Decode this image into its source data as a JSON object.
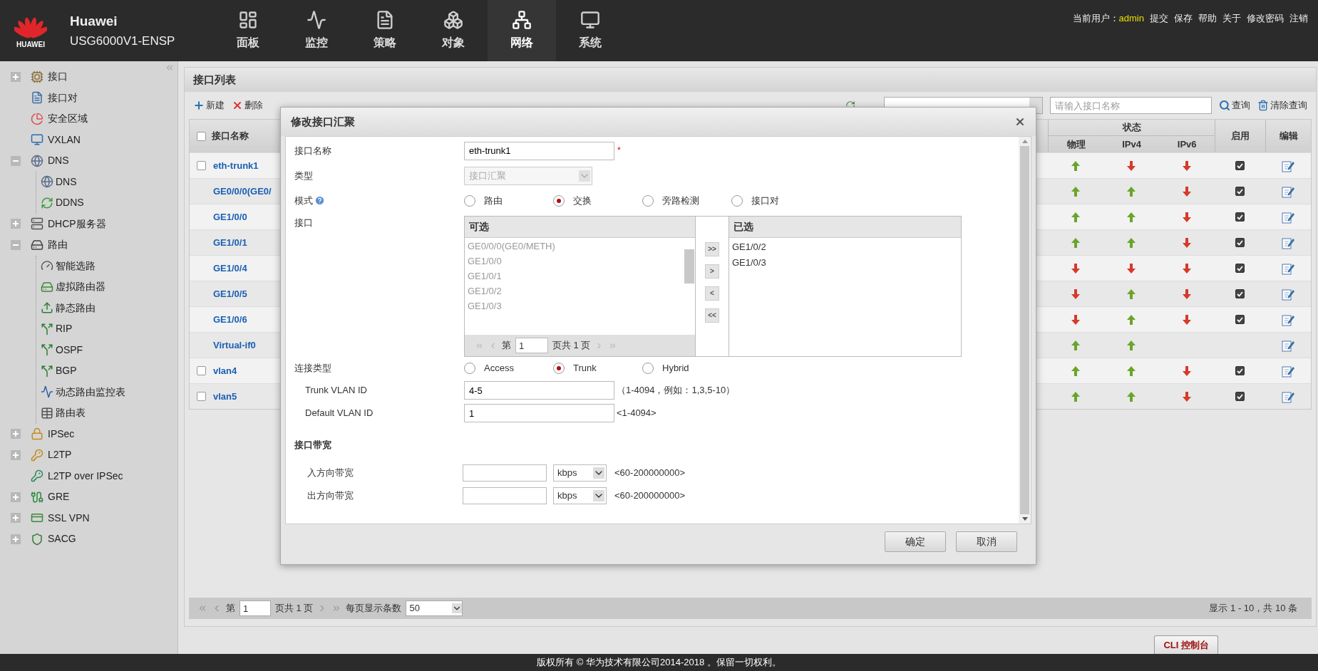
{
  "header": {
    "logo_text": "HUAWEI",
    "brand": "Huawei",
    "model": "USG6000V1-ENSP",
    "nav": [
      {
        "label": "面板",
        "selected": false
      },
      {
        "label": "监控",
        "selected": false
      },
      {
        "label": "策略",
        "selected": false
      },
      {
        "label": "对象",
        "selected": false
      },
      {
        "label": "网络",
        "selected": true
      },
      {
        "label": "系统",
        "selected": false
      }
    ],
    "user_label": "当前用户：",
    "user": "admin",
    "links": [
      "提交",
      "保存",
      "帮助",
      "关于",
      "修改密码",
      "注销"
    ]
  },
  "sidebar": {
    "items": [
      {
        "label": "接口",
        "expanded": false
      },
      {
        "label": "接口对"
      },
      {
        "label": "安全区域"
      },
      {
        "label": "VXLAN"
      },
      {
        "label": "DNS",
        "expanded": true,
        "children": [
          {
            "label": "DNS"
          },
          {
            "label": "DDNS"
          }
        ]
      },
      {
        "label": "DHCP服务器",
        "expanded": false
      },
      {
        "label": "路由",
        "expanded": true,
        "children": [
          {
            "label": "智能选路"
          },
          {
            "label": "虚拟路由器"
          },
          {
            "label": "静态路由"
          },
          {
            "label": "RIP"
          },
          {
            "label": "OSPF"
          },
          {
            "label": "BGP"
          },
          {
            "label": "动态路由监控表"
          },
          {
            "label": "路由表"
          }
        ]
      },
      {
        "label": "IPSec",
        "expanded": false
      },
      {
        "label": "L2TP",
        "expanded": false
      },
      {
        "label": "L2TP over IPSec"
      },
      {
        "label": "GRE",
        "expanded": false
      },
      {
        "label": "SSL VPN",
        "expanded": false
      },
      {
        "label": "SACG",
        "expanded": false
      }
    ]
  },
  "panel": {
    "title": "接口列表",
    "toolbar": {
      "new": "新建",
      "delete": "删除",
      "search_placeholder": "请输入接口名称",
      "query": "查询",
      "clear": "清除查询"
    },
    "table": {
      "select_all_checked": false,
      "columns": {
        "name": "接口名称",
        "status": "状态",
        "physical": "物理",
        "ipv4": "IPv4",
        "ipv6": "IPv6",
        "enabled": "启用",
        "edit": "编辑"
      },
      "rows": [
        {
          "name": "eth-trunk1",
          "checked": false,
          "physical_up": true,
          "ipv4_up": false,
          "ipv6_up": false,
          "enabled": true
        },
        {
          "name": "GE0/0/0(GE0/",
          "physical_up": true,
          "ipv4_up": true,
          "ipv6_up": false,
          "enabled": true
        },
        {
          "name": "GE1/0/0",
          "physical_up": true,
          "ipv4_up": true,
          "ipv6_up": false,
          "enabled": true
        },
        {
          "name": "GE1/0/1",
          "physical_up": true,
          "ipv4_up": true,
          "ipv6_up": false,
          "enabled": true
        },
        {
          "name": "GE1/0/4",
          "physical_up": false,
          "ipv4_up": false,
          "ipv6_up": false,
          "enabled": true
        },
        {
          "name": "GE1/0/5",
          "physical_up": false,
          "ipv4_up": true,
          "ipv6_up": false,
          "enabled": true
        },
        {
          "name": "GE1/0/6",
          "physical_up": false,
          "ipv4_up": true,
          "ipv6_up": false,
          "enabled": true
        },
        {
          "name": "Virtual-if0",
          "physical_up": true,
          "ipv4_up": true
        },
        {
          "name": "vlan4",
          "checked": false,
          "physical_up": true,
          "ipv4_up": true,
          "ipv6_up": false,
          "enabled": true
        },
        {
          "name": "vlan5",
          "checked": false,
          "physical_up": true,
          "ipv4_up": true,
          "ipv6_up": false,
          "enabled": true
        }
      ]
    },
    "pager": {
      "page_label": "第",
      "page": "1",
      "total": "页共 1 页",
      "per_page_label": "每页显示条数",
      "per_page": "50",
      "summary": "显示 1 - 10，共 10 条"
    }
  },
  "dialog": {
    "title": "修改接口汇聚",
    "name": {
      "label": "接口名称",
      "value": "eth-trunk1",
      "required": "*"
    },
    "type": {
      "label": "类型",
      "value": "接口汇聚",
      "disabled": true
    },
    "mode": {
      "label": "模式",
      "options": [
        {
          "label": "路由",
          "selected": false
        },
        {
          "label": "交换",
          "selected": true
        },
        {
          "label": "旁路检测",
          "selected": false
        },
        {
          "label": "接口对",
          "selected": false
        }
      ]
    },
    "interfaces": {
      "label": "接口",
      "available": {
        "title": "可选",
        "items": [
          "GE0/0/0(GE0/METH)",
          "GE1/0/0",
          "GE1/0/1",
          "GE1/0/2",
          "GE1/0/3"
        ],
        "page_label": "第",
        "page": "1",
        "total": "页共 1 页"
      },
      "moves": [
        ">>",
        ">",
        "<",
        "<<"
      ],
      "chosen": {
        "title": "已选",
        "items": [
          "GE1/0/2",
          "GE1/0/3"
        ]
      }
    },
    "link_type": {
      "label": "连接类型",
      "options": [
        {
          "label": "Access",
          "selected": false
        },
        {
          "label": "Trunk",
          "selected": true
        },
        {
          "label": "Hybrid",
          "selected": false
        }
      ]
    },
    "trunk_vlan": {
      "label": "Trunk VLAN ID",
      "value": "4-5",
      "hint": "（1-4094，例如：1,3,5-10）"
    },
    "default_vlan": {
      "label": "Default VLAN ID",
      "value": "1",
      "hint": "<1-4094>"
    },
    "bandwidth": {
      "title": "接口带宽",
      "rows": [
        {
          "label": "入方向带宽",
          "unit": "kbps",
          "hint": "<60-200000000>"
        },
        {
          "label": "出方向带宽",
          "unit": "kbps",
          "hint": "<60-200000000>"
        }
      ]
    },
    "buttons": [
      "确定",
      "取消"
    ]
  },
  "footer": {
    "copyright": "版权所有 © 华为技术有限公司2014-2018 。保留一切权利。",
    "console": "CLI 控制台"
  }
}
